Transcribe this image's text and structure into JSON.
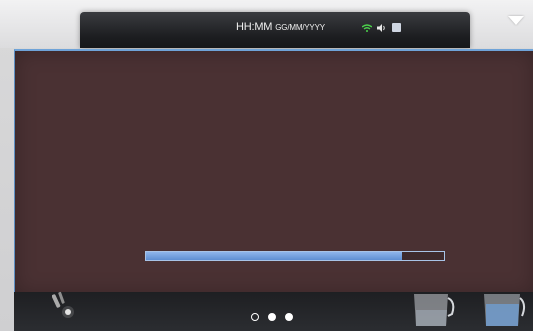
{
  "status_bar": {
    "time_placeholder": "HH:MM",
    "date_placeholder": "GG/MM/YYYY",
    "icons": [
      "wifi-icon",
      "volume-icon",
      "printer-icon"
    ],
    "menu_icon": "dropdown-icon"
  },
  "main_panel": {
    "progress": 0.86,
    "panel_color": "#4a3133",
    "accent_color": "#6fa3d8"
  },
  "bottom_bar": {
    "left_icon": "wand-icon",
    "page_indicator": {
      "total": 3,
      "active_index": 0
    },
    "right_icons": [
      "milk-jug-icon",
      "water-jug-icon"
    ]
  }
}
